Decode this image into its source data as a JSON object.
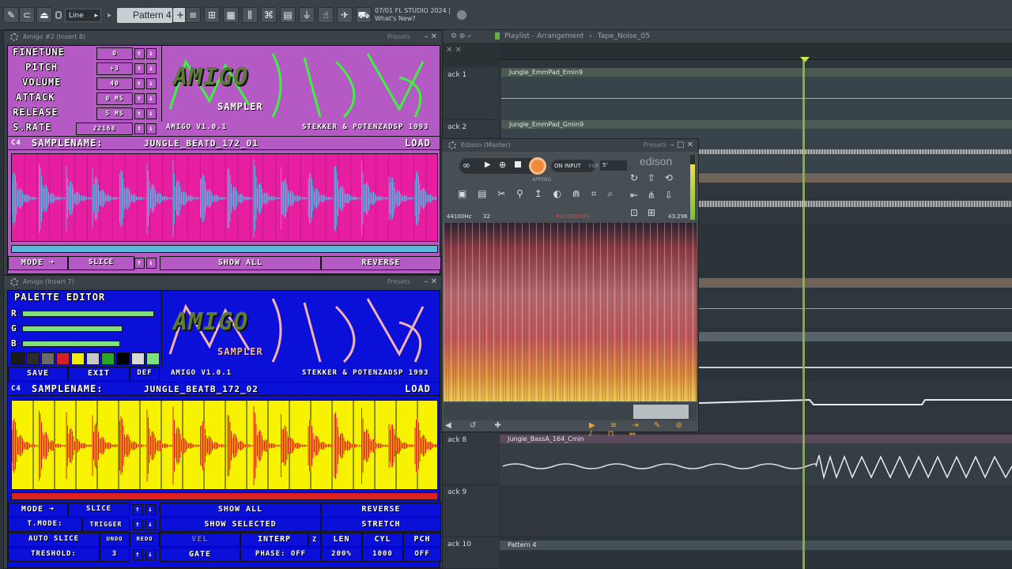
{
  "toolbar": {
    "snap_value": "Line",
    "pattern": "Pattern 4",
    "news_date": "07/01  FL STUDIO 2024 |",
    "news_text": "What's New?"
  },
  "amigo1": {
    "title": "Amigo #2 (Insert 8)",
    "presets": "Presets",
    "params": [
      {
        "label": "FINETUNE",
        "value": "0"
      },
      {
        "label": "PITCH",
        "value": "+3"
      },
      {
        "label": "VOLUME",
        "value": "40"
      },
      {
        "label": "ATTACK",
        "value": "0 MS"
      },
      {
        "label": "RELEASE",
        "value": "5 MS"
      },
      {
        "label": "S.RATE",
        "value": "22168"
      }
    ],
    "version": "AMIGO V1.0.1",
    "credits": "STEKKER & POTENZADSP 1993",
    "note": "C4",
    "samplename_label": "SAMPLENAME:",
    "samplename": "JUNGLE_BEATD_172_01",
    "load": "LOAD",
    "mode_label": "MODE",
    "mode_value": "SLICE",
    "show_all": "SHOW ALL",
    "reverse": "REVERSE",
    "logo": "AMIGO",
    "logo_sub": "SAMPLER"
  },
  "amigo2": {
    "title": "Amigo (Insert 7)",
    "presets": "Presets",
    "palette_title": "PALETTE EDITOR",
    "rgb": [
      {
        "label": "R",
        "level": 0.97
      },
      {
        "label": "G",
        "level": 0.74
      },
      {
        "label": "B",
        "level": 0.72
      }
    ],
    "swatches": [
      "#1a1a1a",
      "#2c2c2c",
      "#6a6a6a",
      "#d42020",
      "#f0f000",
      "#c8c8c8",
      "#22aa22",
      "#000000",
      "#d8d8d8",
      "#7fe07f"
    ],
    "save": "SAVE",
    "exit": "EXIT",
    "def": "DEF",
    "version": "AMIGO V1.0.1",
    "credits": "STEKKER & POTENZADSP 1993",
    "note": "C4",
    "samplename_label": "SAMPLENAME:",
    "samplename": "JUNGLE_BEATB_172_02",
    "load": "LOAD",
    "logo": "AMIGO",
    "logo_sub": "SAMPLER",
    "rows": {
      "mode_label": "MODE",
      "mode_value": "SLICE",
      "show_all": "SHOW ALL",
      "reverse": "REVERSE",
      "tmode_label": "T.MODE:",
      "tmode_value": "TRIGGER",
      "show_selected": "SHOW SELECTED",
      "stretch": "STRETCH",
      "auto_slice": "AUTO SLICE",
      "undo": "UNDO",
      "redo": "REDO",
      "vel": "VEL",
      "interp": "INTERP",
      "z": "Z",
      "len": "LEN",
      "cyl": "CYL",
      "pch": "PCH",
      "treshold_label": "TRESHOLD:",
      "treshold_value": "3",
      "gate": "GATE",
      "phase": "PHASE: OFF",
      "len_value": "200%",
      "cyl_value": "1000",
      "pch_value": "OFF"
    }
  },
  "playlist": {
    "title": "Playlist - Arrangement",
    "project": "Tape_Noise_05",
    "tracks": [
      {
        "name": "ack 1",
        "clip": "Jungle_EmmPad_Emin9"
      },
      {
        "name": "ack 2",
        "clip": "Jungle_EmmPad_Gmin9"
      },
      {
        "name": "ack 8",
        "clip": "Jungle_BassA_164_Cmin"
      },
      {
        "name": "ack 9",
        "clip": ""
      },
      {
        "name": "ack 10",
        "clip": "Pattern 4"
      }
    ]
  },
  "edison": {
    "title": "Edison (Master)",
    "presets": "Presets",
    "on_input": "ON INPUT",
    "for_label": "FOR",
    "for_value": "5'",
    "append": "APPEND",
    "brand": "edison",
    "sample_rate": "44100Hz",
    "bits": "32",
    "status": "RECORDING",
    "length": "43:296"
  }
}
